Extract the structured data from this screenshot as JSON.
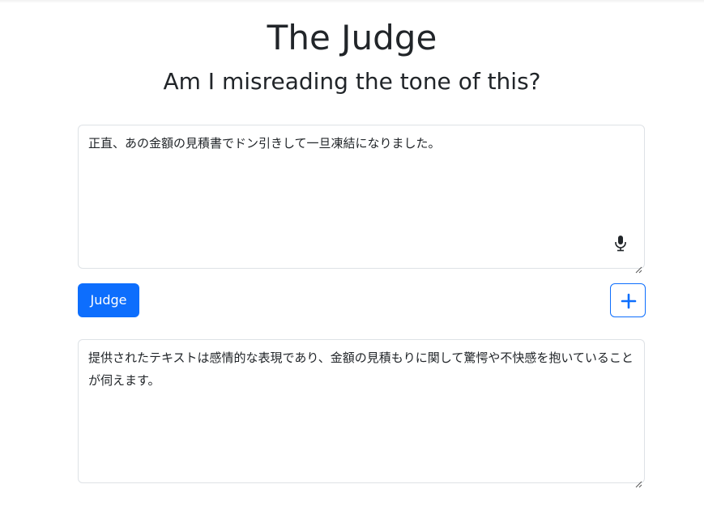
{
  "header": {
    "title": "The Judge",
    "subtitle": "Am I misreading the tone of this?"
  },
  "input": {
    "value": "正直、あの金額の見積書でドン引きして一旦凍結になりました。",
    "mic_icon": "microphone-icon"
  },
  "actions": {
    "judge_label": "Judge",
    "add_icon": "plus-icon"
  },
  "output": {
    "value": "提供されたテキストは感情的な表現であり、金額の見積もりに関して驚愕や不快感を抱いていることが伺えます。"
  },
  "colors": {
    "primary": "#0d6efd",
    "text": "#212529",
    "border": "#dee2e6"
  }
}
